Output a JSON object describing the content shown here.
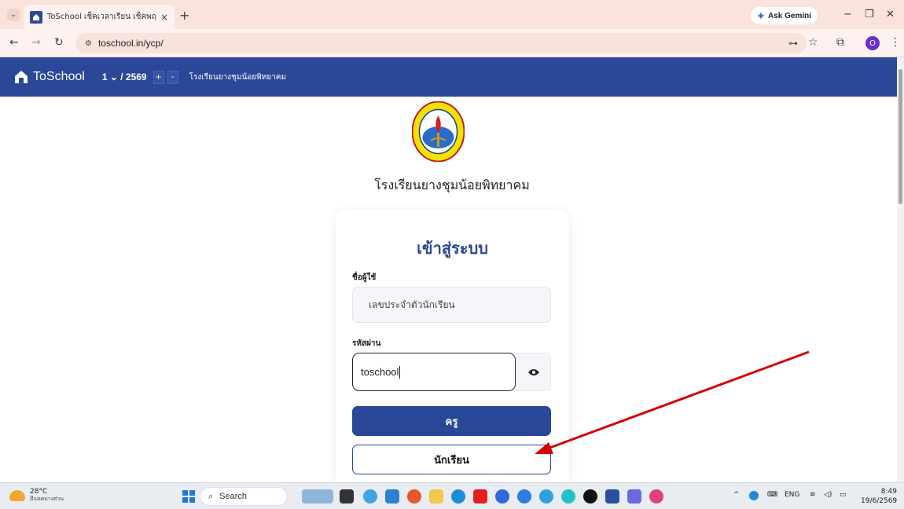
{
  "browser": {
    "tab_title": "ToSchool เช็คเวลาเรียน เช็คพฤติกร",
    "tab_close": "×",
    "new_tab": "+",
    "tab_dropdown": "⌄",
    "ask_gemini": "Ask Gemini",
    "url": "toschool.in/ycp/",
    "profile_initial": "O",
    "window_min": "−",
    "window_restore": "❐",
    "window_close": "✕"
  },
  "header": {
    "brand": "ToSchool",
    "term": "1 ⌄ / 2569",
    "plus": "+",
    "minus": "-",
    "school": "โรงเรียนยางชุมน้อยพิทยาคม"
  },
  "main": {
    "school_title": "โรงเรียนยางชุมน้อยพิทยาคม",
    "login_title": "เข้าสู่ระบบ",
    "username_label": "ชื่อผู้ใช้",
    "username_placeholder": "เลขประจำตัวนักเรียน",
    "password_label": "รหัสผ่าน",
    "password_value": "toschool",
    "teacher_button": "ครู",
    "student_button": "นักเรียน"
  },
  "colors": {
    "accent": "#2a4897",
    "annotation_arrow": "#d40000"
  },
  "taskbar": {
    "temperature": "28°C",
    "weather": "มีแดดบางส่วน",
    "search": "Search",
    "language": "ENG",
    "time": "8:49",
    "date": "19/6/2569"
  }
}
